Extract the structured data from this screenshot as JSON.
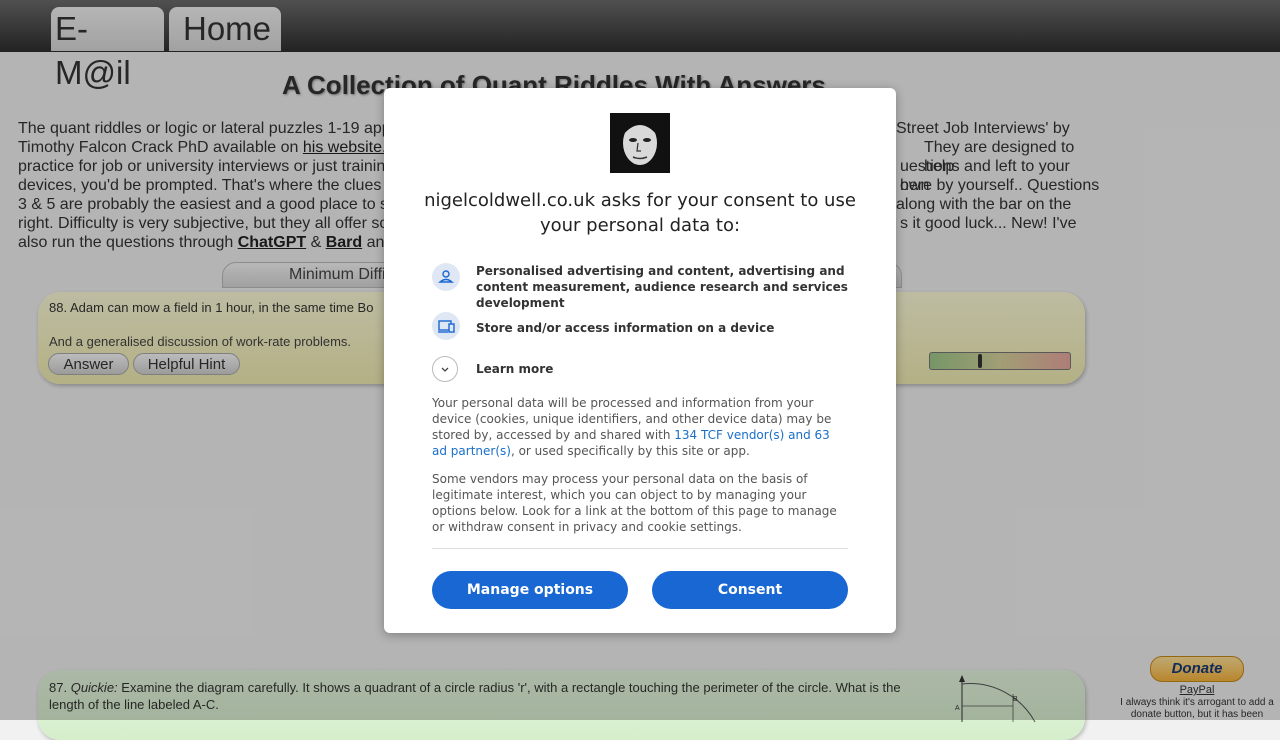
{
  "nav": {
    "email_label": "E-M@il",
    "home_label": "Home"
  },
  "page": {
    "title": "A Collection of Quant Riddles With Answers",
    "intro_lines": [
      "The quant riddles or logic or lateral puzzles 1-19 app",
      "Street Job Interviews' by",
      "Timothy Falcon Crack PhD available on ",
      "his website.",
      "They are designed to help",
      "practice for job or university interviews or just trainin",
      "uestions and left to your own",
      "devices, you'd be prompted. That's where the clues",
      "here by yourself.. Questions",
      "3 & 5 are probably the easiest and a good place to s",
      "along with the bar on the",
      "right. Difficulty is very subjective, but they all offer so",
      "s it good luck... New! I've",
      "also run the questions through ",
      "ChatGPT",
      " & ",
      "Bard",
      " an"
    ],
    "difficulty_label": "Minimum Diffi"
  },
  "riddles": [
    {
      "text": "88. Adam can mow a field in 1 hour, in the same time Bo",
      "sub": "And a generalised discussion of work-rate problems.",
      "answer_label": "Answer",
      "hint_label": "Helpful Hint",
      "difficulty": 0.35
    },
    {
      "number": "87.",
      "tag": "Quickie:",
      "text": " Examine the diagram carefully. It shows a quadrant of a circle radius 'r', with a rectangle touching the perimeter of the circle. What is the length of the line labeled A-C.",
      "diagram_labels": [
        "A",
        "B"
      ]
    }
  ],
  "donate": {
    "button_label": "Donate",
    "paypal_label": "PayPal",
    "note": "I always think it's arrogant to add a donate button, but it has been"
  },
  "consent": {
    "title": "nigelcoldwell.co.uk asks for your consent to use your personal data to:",
    "purposes": [
      {
        "icon": "person-icon",
        "label": "Personalised advertising and content, advertising and content measurement, audience research and services development"
      },
      {
        "icon": "devices-icon",
        "label": "Store and/or access information on a device"
      }
    ],
    "learn_more": "Learn more",
    "para1_a": "Your personal data will be processed and information from your device (cookies, unique identifiers, and other device data) may be stored by, accessed by and shared with ",
    "vendor_link": "134 TCF vendor(s) and 63 ad partner(s)",
    "para1_b": ", or used specifically by this site or app.",
    "para2": "Some vendors may process your personal data on the basis of legitimate interest, which you can object to by managing your options below. Look for a link at the bottom of this page to manage or withdraw consent in privacy and cookie settings.",
    "manage_label": "Manage options",
    "consent_label": "Consent",
    "accent": "#1967d2"
  }
}
